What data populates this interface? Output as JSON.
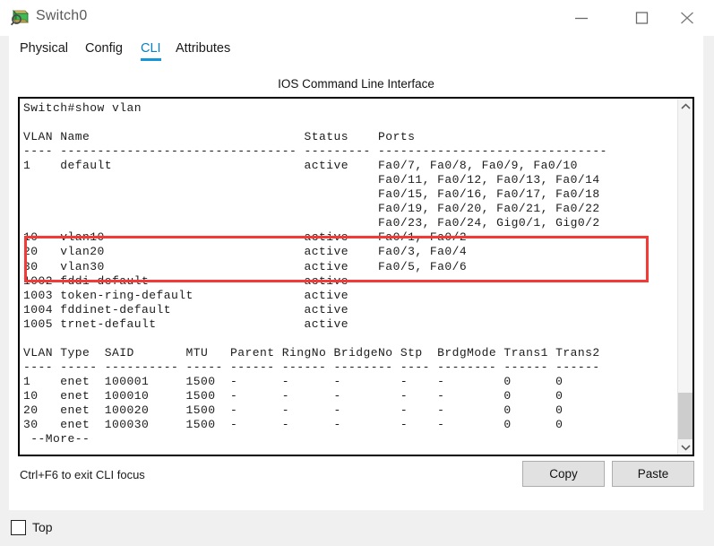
{
  "window": {
    "title": "Switch0",
    "icon": "packet-tracer-device-icon",
    "controls": {
      "minimize": "minimize-icon",
      "maximize": "maximize-icon",
      "close": "close-icon"
    }
  },
  "tabs": [
    {
      "label": "Physical",
      "active": false
    },
    {
      "label": "Config",
      "active": false
    },
    {
      "label": "CLI",
      "active": true
    },
    {
      "label": "Attributes",
      "active": false
    }
  ],
  "content": {
    "heading": "IOS Command Line Interface",
    "terminal_text": "Switch#show vlan\n\nVLAN Name                             Status    Ports\n---- -------------------------------- --------- -------------------------------\n1    default                          active    Fa0/7, Fa0/8, Fa0/9, Fa0/10\n                                                Fa0/11, Fa0/12, Fa0/13, Fa0/14\n                                                Fa0/15, Fa0/16, Fa0/17, Fa0/18\n                                                Fa0/19, Fa0/20, Fa0/21, Fa0/22\n                                                Fa0/23, Fa0/24, Gig0/1, Gig0/2\n10   vlan10                           active    Fa0/1, Fa0/2\n20   vlan20                           active    Fa0/3, Fa0/4\n30   vlan30                           active    Fa0/5, Fa0/6\n1002 fddi-default                     active    \n1003 token-ring-default               active    \n1004 fddinet-default                  active    \n1005 trnet-default                    active    \n\nVLAN Type  SAID       MTU   Parent RingNo BridgeNo Stp  BrdgMode Trans1 Trans2\n---- ----- ---------- ----- ------ ------ -------- ---- -------- ------ ------\n1    enet  100001     1500  -      -      -        -    -        0      0\n10   enet  100010     1500  -      -      -        -    -        0      0\n20   enet  100020     1500  -      -      -        -    -        0      0\n30   enet  100030     1500  -      -      -        -    -        0      0\n --More--",
    "highlight_color": "#f43a36",
    "scrollbar": {
      "up_icon": "chevron-up-icon",
      "down_icon": "chevron-down-icon"
    }
  },
  "bottom": {
    "focus_hint": "Ctrl+F6 to exit CLI focus",
    "copy_label": "Copy",
    "paste_label": "Paste"
  },
  "footer": {
    "top_label": "Top",
    "top_checked": false
  }
}
